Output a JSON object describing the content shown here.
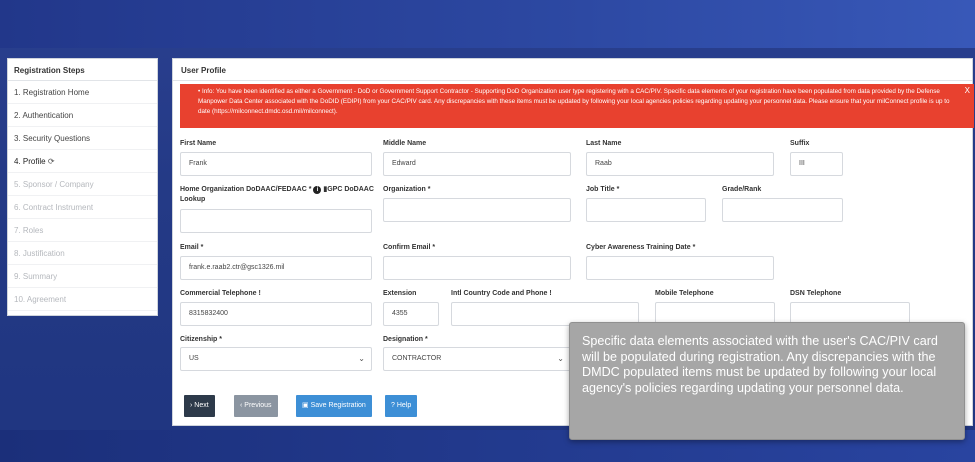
{
  "sidebar": {
    "title": "Registration Steps",
    "steps": [
      {
        "label": "1. Registration Home",
        "state": "done"
      },
      {
        "label": "2. Authentication",
        "state": "done"
      },
      {
        "label": "3. Security Questions",
        "state": "done"
      },
      {
        "label": "4. Profile",
        "state": "active"
      },
      {
        "label": "5. Sponsor / Company",
        "state": "disabled"
      },
      {
        "label": "6. Contract Instrument",
        "state": "disabled"
      },
      {
        "label": "7. Roles",
        "state": "disabled"
      },
      {
        "label": "8. Justification",
        "state": "disabled"
      },
      {
        "label": "9. Summary",
        "state": "disabled"
      },
      {
        "label": "10. Agreement",
        "state": "disabled"
      }
    ],
    "active_icon": "refresh-icon"
  },
  "main": {
    "title": "User Profile",
    "alert": {
      "text": "Info: You have been identified as either a Government - DoD or Government Support Contractor - Supporting DoD Organization user type registering with a CAC/PIV. Specific data elements of your registration have been populated from data provided by the Defense Manpower Data Center associated with the DoDID (EDIPI) from your CAC/PIV card. Any discrepancies with these items must be updated by following your local agencies policies regarding updating your personnel data. Please ensure that your milConnect profile is up to date (https://milconnect.dmdc.osd.mil/milconnect).",
      "close": "X",
      "color": "#e8412f"
    },
    "fields": {
      "first_name": {
        "label": "First Name",
        "value": "Frank"
      },
      "middle_name": {
        "label": "Middle Name",
        "value": "Edward"
      },
      "last_name": {
        "label": "Last Name",
        "value": "Raab"
      },
      "suffix": {
        "label": "Suffix",
        "value": "III"
      },
      "home_org": {
        "label": "Home Organization DoDAAC/FEDAAC *",
        "value": "",
        "lookup": "GPC DoDAAC Lookup",
        "info_icon": "info-circle-icon",
        "lookup_icon": "book-icon"
      },
      "organization": {
        "label": "Organization *",
        "value": ""
      },
      "job_title": {
        "label": "Job Title *",
        "value": ""
      },
      "grade_rank": {
        "label": "Grade/Rank",
        "value": ""
      },
      "email": {
        "label": "Email *",
        "value": "frank.e.raab2.ctr@gsc1326.mil"
      },
      "confirm_email": {
        "label": "Confirm Email *",
        "value": ""
      },
      "cyber_date": {
        "label": "Cyber Awareness Training Date *",
        "value": ""
      },
      "commercial_phone": {
        "label": "Commercial Telephone !",
        "value": "8315832400"
      },
      "extension": {
        "label": "Extension",
        "value": "4355"
      },
      "intl_phone": {
        "label": "Intl Country Code and Phone !",
        "value": ""
      },
      "mobile_phone": {
        "label": "Mobile Telephone",
        "value": ""
      },
      "dsn_phone": {
        "label": "DSN Telephone",
        "value": ""
      },
      "citizenship": {
        "label": "Citizenship *",
        "value": "US"
      },
      "designation": {
        "label": "Designation *",
        "value": "CONTRACTOR"
      }
    },
    "buttons": {
      "next": "Next",
      "previous": "Previous",
      "save": "Save Registration",
      "help": "Help"
    }
  },
  "tooltip": {
    "text": "Specific data elements associated with the user's CAC/PIV card will be populated during registration. Any discrepancies with the DMDC populated items must be updated by following your local agency's policies regarding updating your personnel data."
  }
}
